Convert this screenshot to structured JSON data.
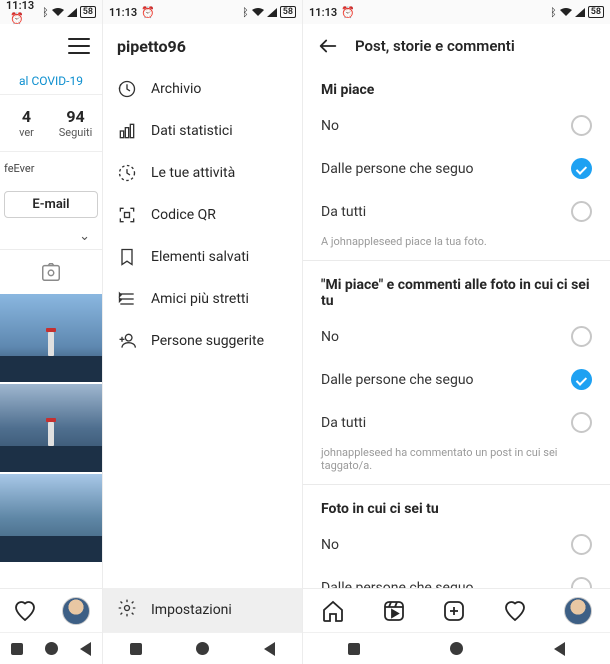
{
  "status": {
    "time": "11:13"
  },
  "colA": {
    "covid": "al COVID-19",
    "stat1_num": "4",
    "stat1_lbl": "ver",
    "stat2_num": "94",
    "stat2_lbl": "Seguiti",
    "bio": "feEver",
    "email": "E-mail"
  },
  "colB": {
    "username": "pipetto96",
    "items": [
      {
        "icon": "archive",
        "label": "Archivio"
      },
      {
        "icon": "insights",
        "label": "Dati statistici"
      },
      {
        "icon": "activity",
        "label": "Le tue attività"
      },
      {
        "icon": "qr",
        "label": "Codice QR"
      },
      {
        "icon": "saved",
        "label": "Elementi salvati"
      },
      {
        "icon": "close-friends",
        "label": "Amici più stretti"
      },
      {
        "icon": "suggested",
        "label": "Persone suggerite"
      }
    ],
    "settings": "Impostazioni"
  },
  "colC": {
    "title": "Post, storie e commenti",
    "sections": [
      {
        "title": "Mi piace",
        "options": [
          {
            "label": "No",
            "sel": false
          },
          {
            "label": "Dalle persone che seguo",
            "sel": true
          },
          {
            "label": "Da tutti",
            "sel": false
          }
        ],
        "hint": "A johnappleseed piace la tua foto."
      },
      {
        "title": "\"Mi piace\" e commenti alle foto in cui ci sei tu",
        "options": [
          {
            "label": "No",
            "sel": false
          },
          {
            "label": "Dalle persone che seguo",
            "sel": true
          },
          {
            "label": "Da tutti",
            "sel": false
          }
        ],
        "hint": "johnappleseed ha commentato un post in cui sei taggato/a."
      },
      {
        "title": "Foto in cui ci sei tu",
        "options": [
          {
            "label": "No",
            "sel": false
          },
          {
            "label": "Dalle persone che seguo",
            "sel": false
          }
        ],
        "hint": ""
      }
    ]
  }
}
